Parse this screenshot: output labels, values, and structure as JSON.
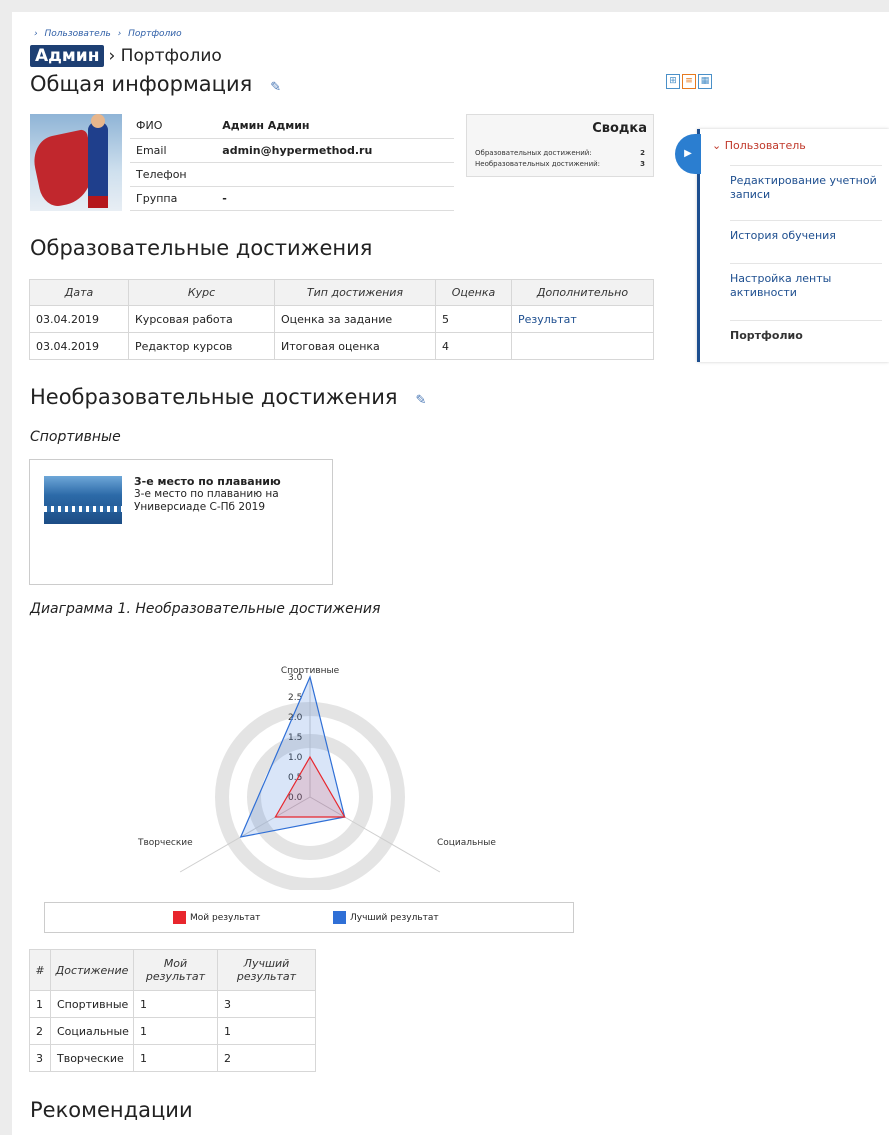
{
  "breadcrumbs": [
    "›",
    "Пользователь",
    "›",
    "Портфолио"
  ],
  "header": {
    "badge": "Админ",
    "separator": "›",
    "page": "Портфолио"
  },
  "general": {
    "title": "Общая информация",
    "rows": [
      {
        "label": "ФИО",
        "value": "Админ Админ"
      },
      {
        "label": "Email",
        "value": "admin@hypermethod.ru"
      },
      {
        "label": "Телефон",
        "value": ""
      },
      {
        "label": "Группа",
        "value": "-"
      }
    ]
  },
  "summary": {
    "title": "Сводка",
    "rows": [
      {
        "label": "Образовательных достижений:",
        "value": "2"
      },
      {
        "label": "Необразовательных достижений:",
        "value": "3"
      }
    ]
  },
  "sidebar": {
    "section": "Пользователь",
    "items": [
      "Редактирование учетной записи",
      "История обучения",
      "Настройка ленты активности",
      "Портфолио"
    ]
  },
  "edu": {
    "title": "Образовательные достижения",
    "columns": [
      "Дата",
      "Курс",
      "Тип достижения",
      "Оценка",
      "Дополнительно"
    ],
    "rows": [
      [
        "03.04.2019",
        "Курсовая работа",
        "Оценка за задание",
        "5",
        "Результат"
      ],
      [
        "03.04.2019",
        "Редактор курсов",
        "Итоговая оценка",
        "4",
        ""
      ]
    ]
  },
  "nonedu": {
    "title": "Необразовательные достижения",
    "category": "Спортивные",
    "card": {
      "title": "3-е место по плаванию",
      "desc": "3-е место по плаванию на Универсиаде С-Пб 2019"
    }
  },
  "diagram": {
    "caption": "Диаграмма 1. Необразовательные достижения",
    "legend": [
      "Мой результат",
      "Лучший результат"
    ]
  },
  "chart_data": {
    "type": "radar",
    "categories": [
      "Спортивные",
      "Социальные",
      "Творческие"
    ],
    "series": [
      {
        "name": "Мой результат",
        "values": [
          1,
          1,
          1
        ],
        "color": "#e8262d"
      },
      {
        "name": "Лучший результат",
        "values": [
          3,
          1,
          2
        ],
        "color": "#2f6fd6"
      }
    ],
    "ticks": [
      "0.0",
      "0.5",
      "1.0",
      "1.5",
      "2.0",
      "2.5",
      "3.0"
    ],
    "range": [
      0,
      3
    ]
  },
  "result_table": {
    "columns": [
      "#",
      "Достижение",
      "Мой результат",
      "Лучший результат"
    ],
    "rows": [
      [
        "1",
        "Спортивные",
        "1",
        "3"
      ],
      [
        "2",
        "Социальные",
        "1",
        "1"
      ],
      [
        "3",
        "Творческие",
        "1",
        "2"
      ]
    ]
  },
  "recommendations": {
    "title": "Рекомендации"
  },
  "icons": {
    "edit": "pencil-icon",
    "views": [
      "tree-view-icon",
      "list-view-icon",
      "table-view-icon"
    ]
  }
}
